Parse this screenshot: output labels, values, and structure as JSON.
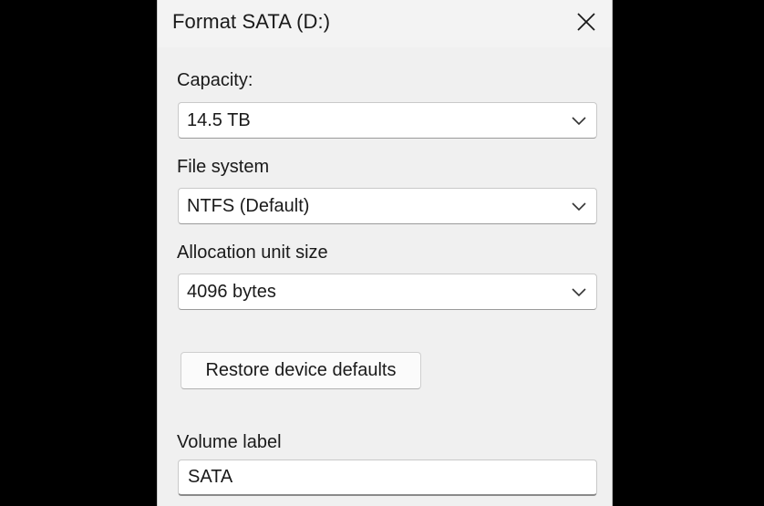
{
  "dialog": {
    "title": "Format SATA (D:)",
    "close_icon": "close-icon"
  },
  "capacity": {
    "label": "Capacity:",
    "value": "14.5 TB"
  },
  "file_system": {
    "label": "File system",
    "value": "NTFS (Default)"
  },
  "allocation": {
    "label": "Allocation unit size",
    "value": "4096 bytes"
  },
  "restore_button": {
    "label": "Restore device defaults"
  },
  "volume_label": {
    "label": "Volume label",
    "value": "SATA"
  },
  "icons": {
    "dropdown": "chevron-down-icon"
  }
}
